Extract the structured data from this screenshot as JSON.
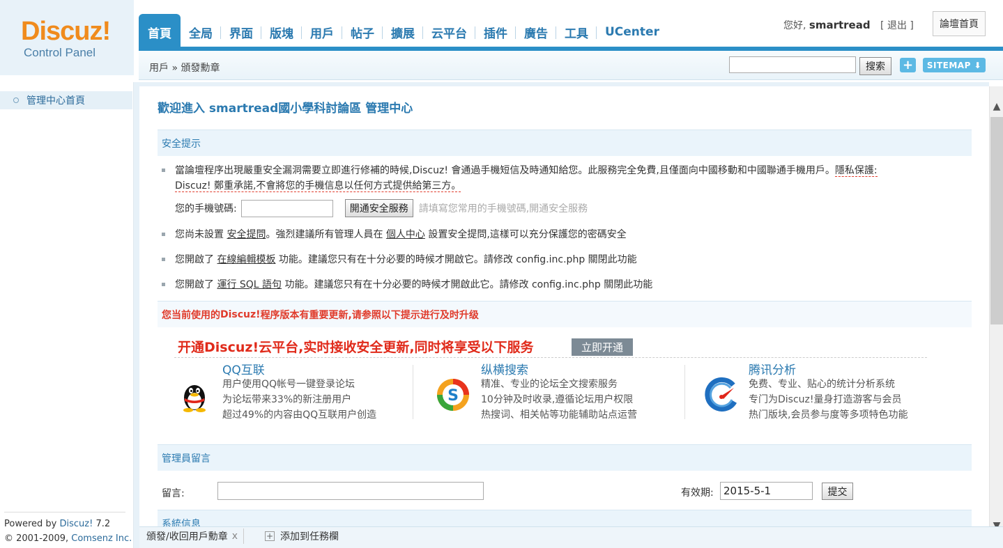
{
  "logo": {
    "brand": "Discuz!",
    "subtitle": "Control Panel"
  },
  "tabs": [
    {
      "label": "首頁"
    },
    {
      "label": "全局"
    },
    {
      "label": "界面"
    },
    {
      "label": "版塊"
    },
    {
      "label": "用戶"
    },
    {
      "label": "帖子"
    },
    {
      "label": "擴展"
    },
    {
      "label": "云平台"
    },
    {
      "label": "插件"
    },
    {
      "label": "廣告"
    },
    {
      "label": "工具"
    },
    {
      "label": "UCenter"
    }
  ],
  "header": {
    "greeting": "您好,",
    "username": "smartread",
    "bracket_open": "[",
    "logout": "退出",
    "bracket_close": "]",
    "forum_home": "論壇首頁"
  },
  "subbar": {
    "breadcrumb": "用戶 » 頒發勳章",
    "search_button": "搜索",
    "plus": "+",
    "sitemap": "SITEMAP ⬇"
  },
  "sidebar": {
    "item": "管理中心首頁",
    "powered_prefix": "Powered by ",
    "powered_link": "Discuz!",
    "powered_version": " 7.2",
    "copyright_prefix": "© 2001-2009, ",
    "copyright_link": "Comsenz Inc."
  },
  "main": {
    "welcome": "歡迎進入 smartread國小學科討論區 管理中心",
    "security_title": "安全提示",
    "tip1_a": "當論壇程序出現嚴重安全漏洞需要立即進行修補的時候,Discuz! 會通過手機短信及時通知給您。此服務完全免費,且僅面向中國移動和中國聯通手機用戶。",
    "tip1_privacy": "隱私保護:",
    "tip1_b": "Discuz! 鄭重承諾,不會將您的手機信息以任何方式提供給第三方。",
    "phone_label": "您的手機號碼:",
    "phone_button": "開通安全服務",
    "phone_hint": "請填寫您常用的手機號碼,開通安全服務",
    "tip2_a": "您尚未設置 ",
    "tip2_link1": "安全提問",
    "tip2_b": "。強烈建議所有管理人員在 ",
    "tip2_link2": "個人中心",
    "tip2_c": " 設置安全提問,這樣可以充分保護您的密碼安全",
    "tip3_a": "您開啟了 ",
    "tip3_link": "在線編輯模板",
    "tip3_b": " 功能。建議您只有在十分必要的時候才開啟它。請修改 config.inc.php 關閉此功能",
    "tip4_a": "您開啟了 ",
    "tip4_link": "運行 SQL 語句",
    "tip4_b": " 功能。建議您只有在十分必要的時候才開啟此它。請修改 config.inc.php 關閉此功能",
    "update_a": "您当前使用的 ",
    "update_brand": "Discuz!",
    "update_b": " 程序版本有重要更新,请参照以下提示进行及时升级",
    "cloud_title": "开通Discuz!云平台,实时接收安全更新,同时将享受以下服务",
    "cloud_button": "立即开通",
    "services": [
      {
        "title": "QQ互联",
        "lines": [
          "用户使用QQ帐号一键登录论坛",
          "为论坛带来33%的新注册用户",
          "超过49%的内容由QQ互联用户创造"
        ]
      },
      {
        "title": "纵横搜索",
        "lines": [
          "精准、专业的论坛全文搜索服务",
          "10分钟及时收录,遵循论坛用户权限",
          "热搜词、相关帖等功能辅助站点运营"
        ]
      },
      {
        "title": "腾讯分析",
        "lines": [
          "免费、专业、贴心的统计分析系统",
          "专门为Discuz!量身打造游客与会员",
          "热门版块,会员参与度等多项特色功能"
        ]
      }
    ],
    "admin_msg_title": "管理員留言",
    "msg_label": "留言:",
    "expiry_label": "有效期:",
    "expiry_value": "2015-5-1",
    "submit": "提交",
    "sysinfo_title": "系統信息"
  },
  "taskbar": {
    "item": "頒發/收回用戶勳章",
    "close": "x",
    "add": "添加到任務欄",
    "add_icon": "+"
  },
  "scrollbar": {
    "up": "▲",
    "down": "▼"
  },
  "colors": {
    "accent": "#2b8fc7",
    "link": "#2b7ab0",
    "logo": "#f08b1d",
    "alert": "#e02a1a"
  }
}
